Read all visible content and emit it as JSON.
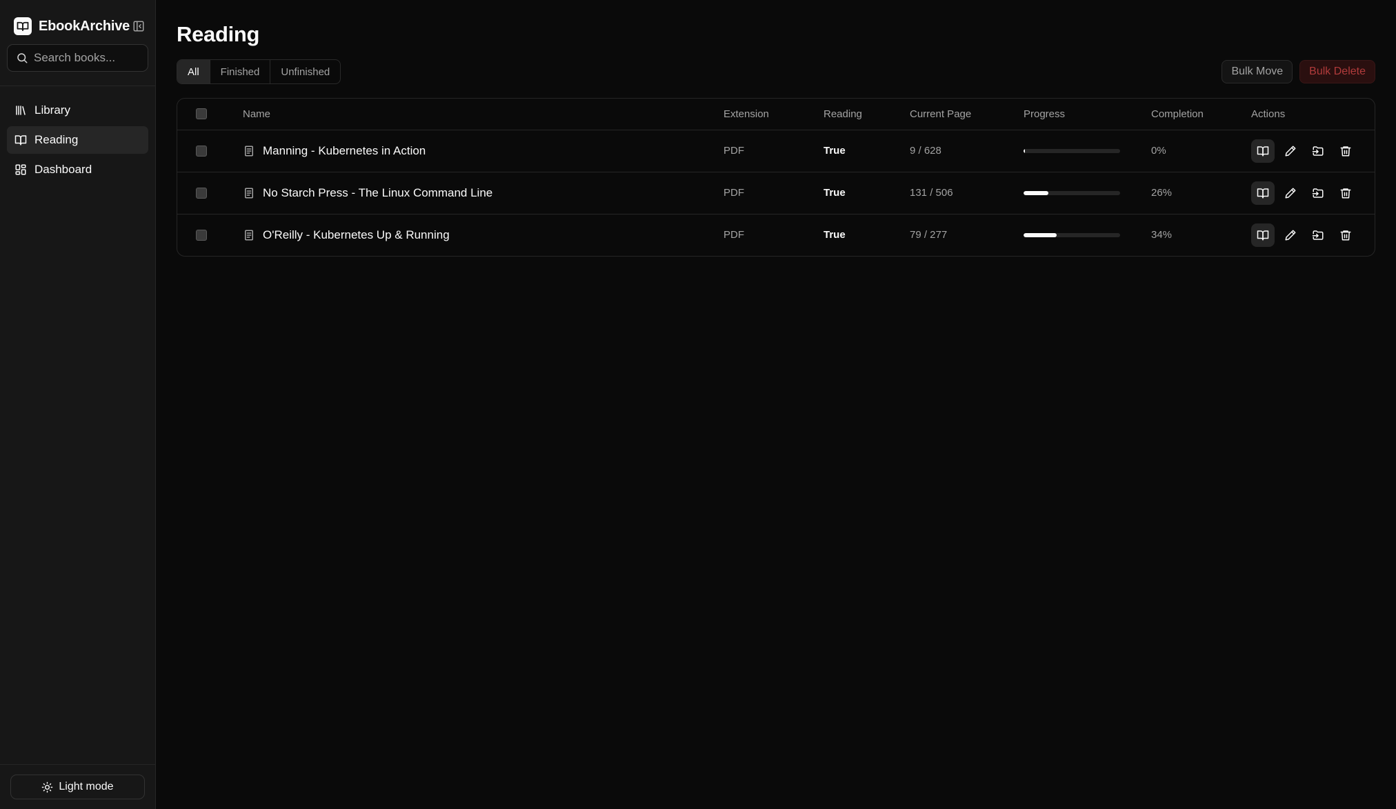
{
  "app": {
    "name": "EbookArchive"
  },
  "search": {
    "placeholder": "Search books..."
  },
  "nav": {
    "items": [
      {
        "label": "Library",
        "icon": "library-icon",
        "active": false
      },
      {
        "label": "Reading",
        "icon": "book-open-icon",
        "active": true
      },
      {
        "label": "Dashboard",
        "icon": "dashboard-icon",
        "active": false
      }
    ]
  },
  "footer": {
    "mode_label": "Light mode"
  },
  "page": {
    "title": "Reading"
  },
  "filters": {
    "tabs": [
      {
        "label": "All",
        "active": true
      },
      {
        "label": "Finished",
        "active": false
      },
      {
        "label": "Unfinished",
        "active": false
      }
    ]
  },
  "bulk": {
    "move_label": "Bulk Move",
    "delete_label": "Bulk Delete"
  },
  "table": {
    "columns": {
      "name": "Name",
      "extension": "Extension",
      "reading": "Reading",
      "current_page": "Current Page",
      "progress": "Progress",
      "completion": "Completion",
      "actions": "Actions"
    },
    "rows": [
      {
        "name": "Manning - Kubernetes in Action",
        "extension": "PDF",
        "reading": "True",
        "current_page": "9 / 628",
        "progress": 1.4,
        "completion": "0%"
      },
      {
        "name": "No Starch Press - The Linux Command Line",
        "extension": "PDF",
        "reading": "True",
        "current_page": "131 / 506",
        "progress": 26,
        "completion": "26%"
      },
      {
        "name": "O'Reilly - Kubernetes Up & Running",
        "extension": "PDF",
        "reading": "True",
        "current_page": "79 / 277",
        "progress": 34,
        "completion": "34%"
      }
    ]
  },
  "colors": {
    "background": "#0a0a0a",
    "sidebar": "#171717",
    "danger": "#b13b3b"
  }
}
